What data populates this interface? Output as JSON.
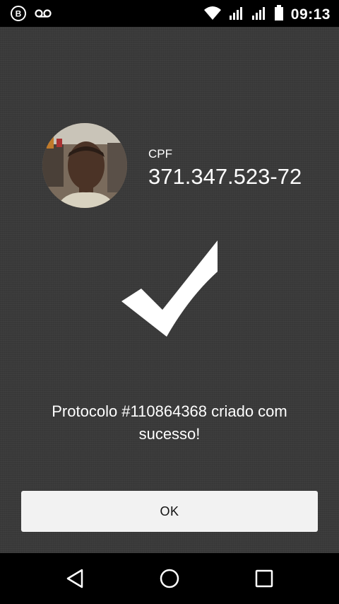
{
  "status_bar": {
    "time": "09:13",
    "left_icons": [
      "b-circle-icon",
      "voicemail-icon"
    ],
    "right_icons": [
      "wifi-icon",
      "signal-icon",
      "signal-icon",
      "battery-icon"
    ]
  },
  "profile": {
    "avatar": "user-photo",
    "cpf_label": "CPF",
    "cpf_value": "371.347.523-72"
  },
  "result": {
    "icon": "checkmark-icon",
    "message": "Protocolo #110864368 criado com sucesso!"
  },
  "actions": {
    "ok_label": "OK"
  },
  "nav_bar": {
    "buttons": [
      "back-icon",
      "home-icon",
      "recents-icon"
    ]
  },
  "colors": {
    "background": "#3a3a3a",
    "bars": "#000000",
    "button": "#f2f2f2",
    "text": "#ffffff"
  }
}
